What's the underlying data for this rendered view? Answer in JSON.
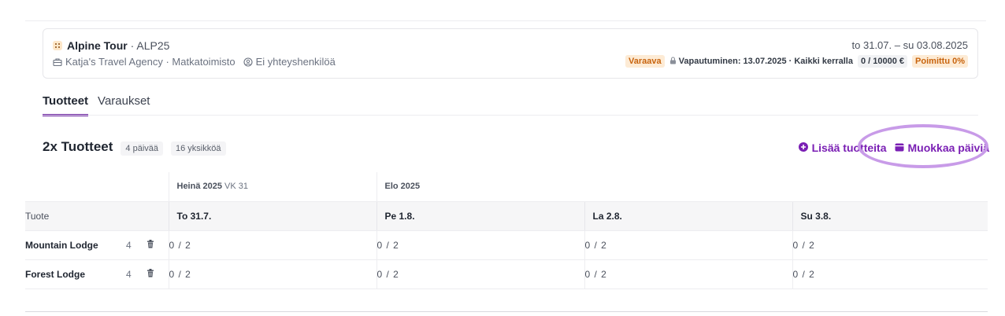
{
  "header": {
    "tour_name": "Alpine Tour",
    "tour_code": "· ALP25",
    "agency": "Katja's Travel Agency · Matkatoimisto",
    "contact": "Ei yhteyshenkilöä",
    "dates": "to 31.07. – su 03.08.2025",
    "status_badge": "Varaava",
    "release": "Vapautuminen: 13.07.2025 · Kaikki kerralla",
    "amount": "0 / 10000 €",
    "picked_badge": "Poimittu 0%"
  },
  "tabs": [
    {
      "label": "Tuotteet",
      "active": true
    },
    {
      "label": "Varaukset",
      "active": false
    }
  ],
  "section": {
    "title": "2x Tuotteet",
    "days_pill": "4 päivää",
    "units_pill": "16 yksikköä",
    "add_products": "Lisää tuotteita",
    "edit_days": "Muokkaa päiviä"
  },
  "table": {
    "months": [
      {
        "label": "Heinä 2025",
        "week": "VK 31"
      },
      {
        "label": "Elo 2025",
        "week": ""
      }
    ],
    "product_header": "Tuote",
    "days": [
      "To 31.7.",
      "Pe 1.8.",
      "La 2.8.",
      "Su 3.8."
    ],
    "rows": [
      {
        "name": "Mountain Lodge",
        "qty": "4",
        "cells": [
          "0 / 2",
          "0 / 2",
          "0 / 2",
          "0 / 2"
        ]
      },
      {
        "name": "Forest Lodge",
        "qty": "4",
        "cells": [
          "0 / 2",
          "0 / 2",
          "0 / 2",
          "0 / 2"
        ]
      }
    ]
  },
  "colors": {
    "accent": "#7a1fb4",
    "highlight": "#c89be8",
    "badge_orange_bg": "#fdebd5",
    "badge_orange_text": "#c8640e"
  }
}
